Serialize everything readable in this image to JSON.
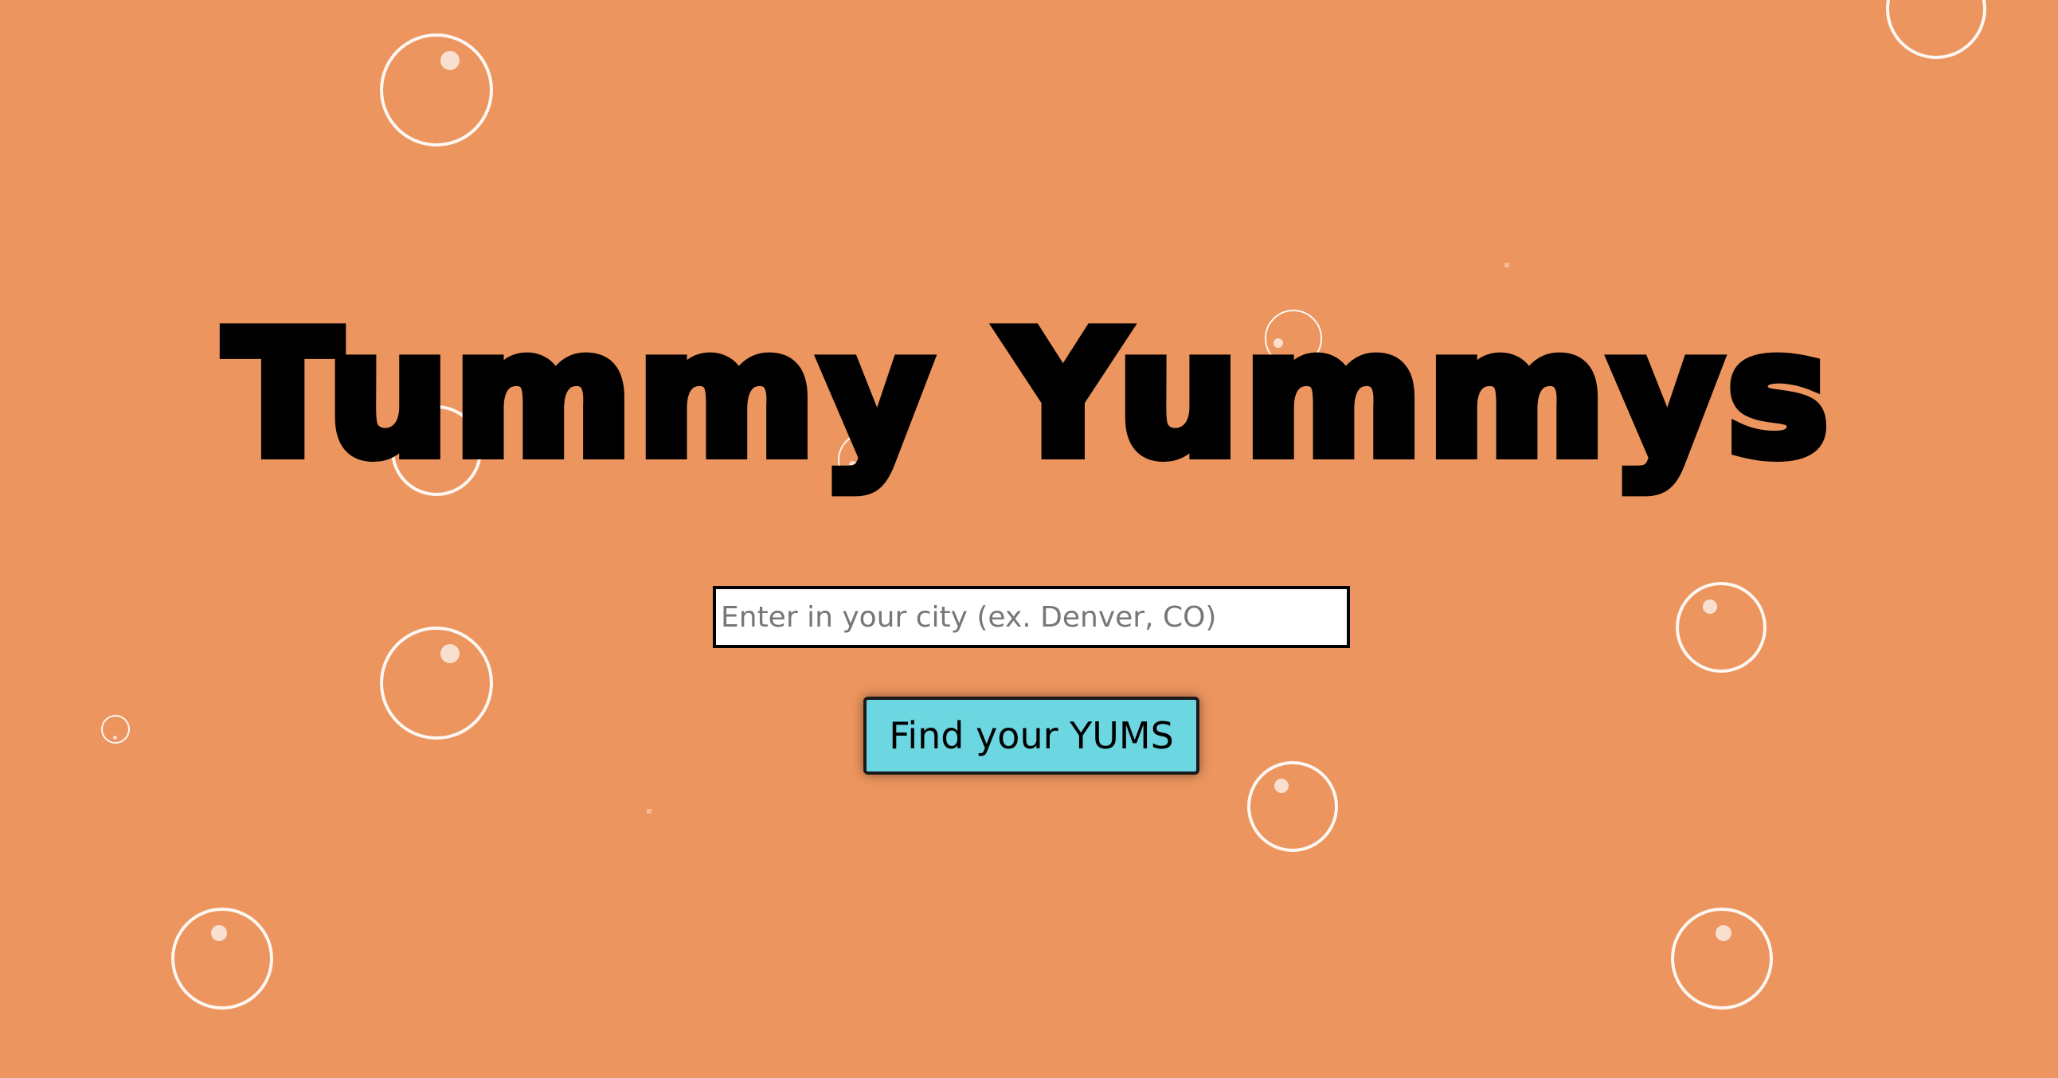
{
  "app": {
    "title": "Tummy Yummys"
  },
  "search": {
    "placeholder": "Enter in your city (ex. Denver, CO)",
    "value": ""
  },
  "actions": {
    "find_label": "Find your YUMS"
  },
  "colors": {
    "background": "#EC955E",
    "button": "#6CD6E1",
    "bubble": "#FFFFFF",
    "title": "#000000"
  }
}
